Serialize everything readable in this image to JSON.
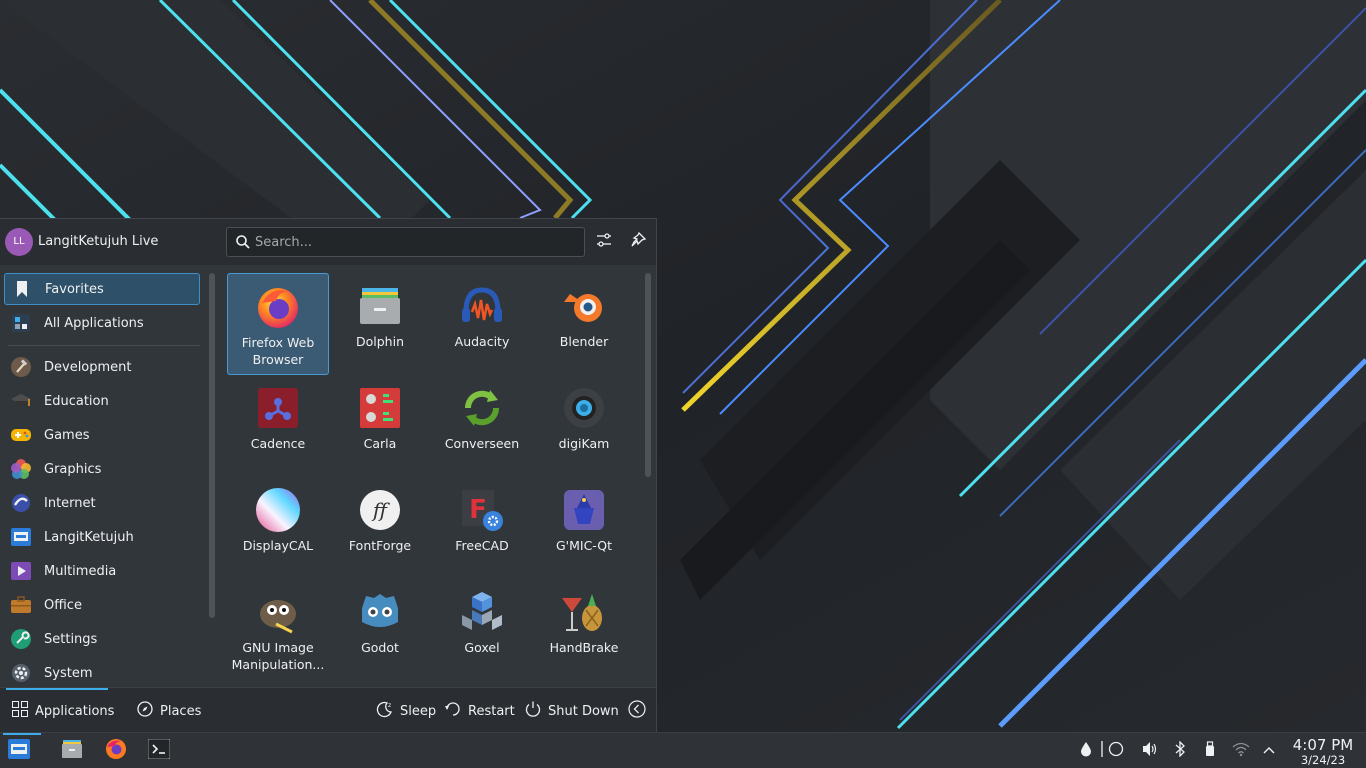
{
  "user": {
    "initials": "LL",
    "name": "LangitKetujuh Live"
  },
  "search": {
    "placeholder": "Search..."
  },
  "categories": [
    {
      "label": "Favorites",
      "icon": "bookmark-icon"
    },
    {
      "label": "All Applications",
      "icon": "all-apps-icon"
    },
    {
      "label": "Development",
      "icon": "hammer-icon"
    },
    {
      "label": "Education",
      "icon": "graduation-cap-icon"
    },
    {
      "label": "Games",
      "icon": "gamepad-icon"
    },
    {
      "label": "Graphics",
      "icon": "color-petals-icon"
    },
    {
      "label": "Internet",
      "icon": "globe-icon"
    },
    {
      "label": "LangitKetujuh",
      "icon": "langitketujuh-icon"
    },
    {
      "label": "Multimedia",
      "icon": "multimedia-icon"
    },
    {
      "label": "Office",
      "icon": "briefcase-icon"
    },
    {
      "label": "Settings",
      "icon": "settings-wrench-icon"
    },
    {
      "label": "System",
      "icon": "system-gear-icon"
    }
  ],
  "apps": [
    {
      "label": "Firefox Web Browser",
      "icon": "firefox-icon"
    },
    {
      "label": "Dolphin",
      "icon": "dolphin-icon"
    },
    {
      "label": "Audacity",
      "icon": "audacity-icon"
    },
    {
      "label": "Blender",
      "icon": "blender-icon"
    },
    {
      "label": "Cadence",
      "icon": "cadence-icon"
    },
    {
      "label": "Carla",
      "icon": "carla-icon"
    },
    {
      "label": "Converseen",
      "icon": "converseen-icon"
    },
    {
      "label": "digiKam",
      "icon": "digikam-icon"
    },
    {
      "label": "DisplayCAL",
      "icon": "displaycal-icon"
    },
    {
      "label": "FontForge",
      "icon": "fontforge-icon"
    },
    {
      "label": "FreeCAD",
      "icon": "freecad-icon"
    },
    {
      "label": "G'MIC-Qt",
      "icon": "gmic-icon"
    },
    {
      "label": "GNU Image Manipulation...",
      "icon": "gimp-icon"
    },
    {
      "label": "Godot",
      "icon": "godot-icon"
    },
    {
      "label": "Goxel",
      "icon": "goxel-icon"
    },
    {
      "label": "HandBrake",
      "icon": "handbrake-icon"
    }
  ],
  "footer": {
    "tabs": [
      {
        "label": "Applications",
        "icon": "grid-icon"
      },
      {
        "label": "Places",
        "icon": "compass-icon"
      }
    ],
    "power": [
      {
        "label": "Sleep",
        "icon": "sleep-icon"
      },
      {
        "label": "Restart",
        "icon": "restart-icon"
      },
      {
        "label": "Shut Down",
        "icon": "power-icon"
      }
    ]
  },
  "taskbar": {
    "pinned": [
      "launcher-icon",
      "file-manager-icon",
      "firefox-icon",
      "terminal-icon"
    ]
  },
  "clock": {
    "time": "4:07 PM",
    "date": "3/24/23"
  },
  "colors": {
    "accent": "#3daee9",
    "panel": "#31363b",
    "taskbar": "#2f3338"
  }
}
